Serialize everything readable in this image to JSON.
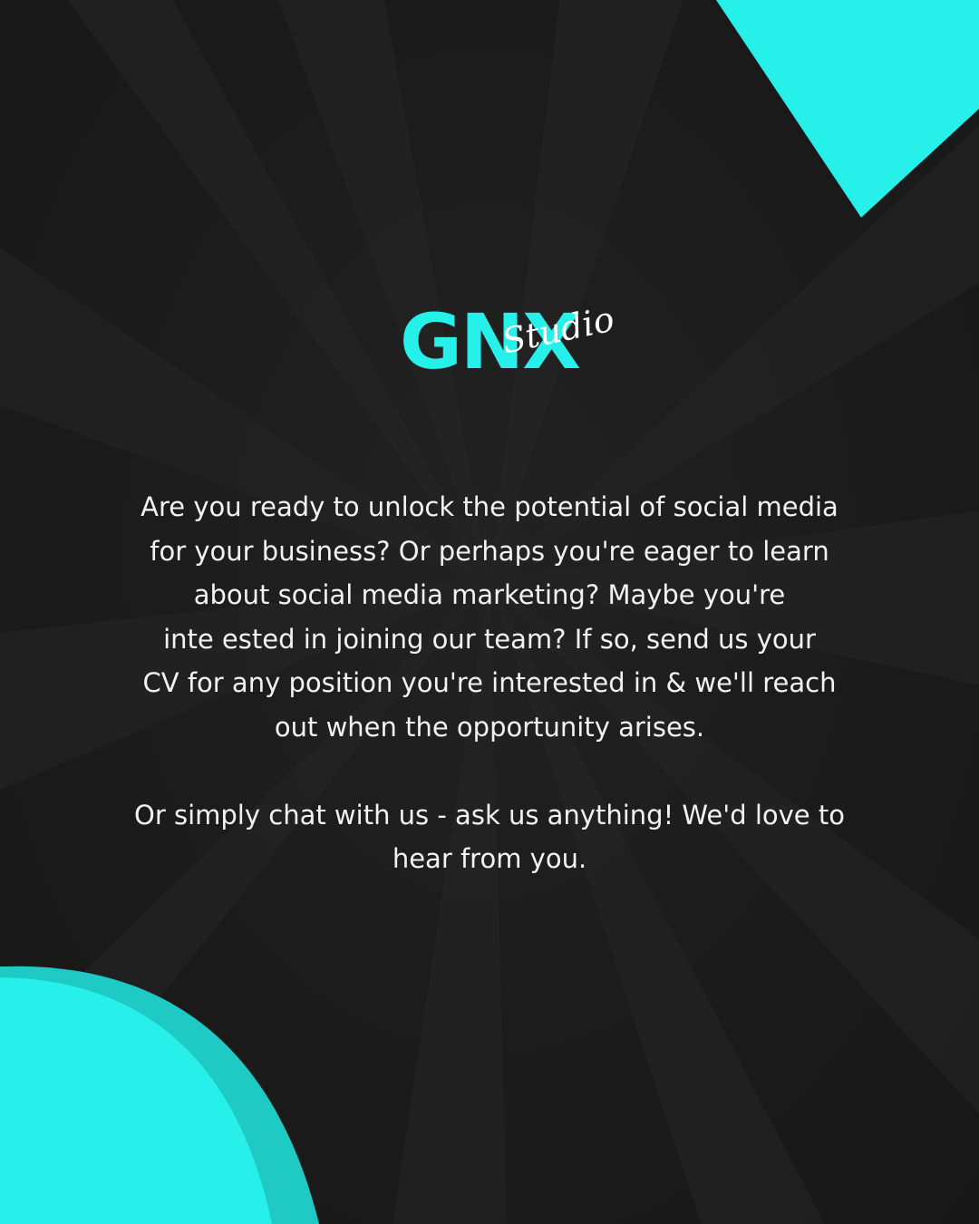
{
  "logo": {
    "main": "GNX",
    "script": "Studio"
  },
  "paragraph_1_lines": [
    "Are you ready to unlock the potential of social media",
    "for your business? Or perhaps you're eager to learn",
    "about social media marketing?  Maybe you're",
    "inte ested in joining our team? If so, send us your",
    "CV for any position you're interested in & we'll reach",
    "out when the opportunity arises."
  ],
  "paragraph_2_lines": [
    "Or simply chat with us - ask us anything! We'd love to",
    "hear from you."
  ],
  "colors": {
    "background": "#1b1b1b",
    "accent": "#27f0ea",
    "accent_dark": "#1fc9c4",
    "text": "#f2f2f2"
  }
}
